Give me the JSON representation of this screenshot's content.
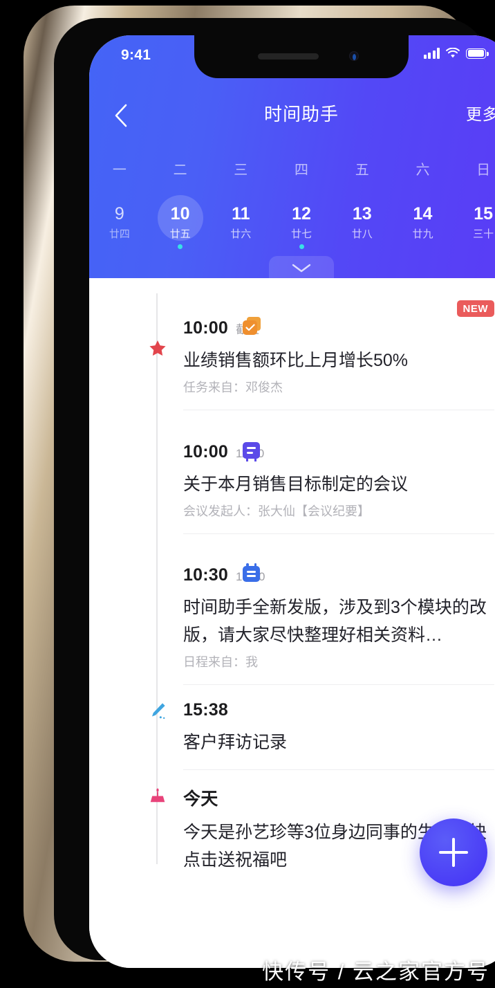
{
  "status_bar": {
    "time": "9:41",
    "signal_icon": "signal-bars-icon",
    "wifi_icon": "wifi-icon",
    "battery_icon": "battery-icon"
  },
  "header": {
    "back_icon": "chevron-left-icon",
    "title": "时间助手",
    "more_label": "更多",
    "expand_icon": "chevron-down-icon",
    "gradient_from": "#4464f6",
    "gradient_to": "#5a3cf6"
  },
  "calendar": {
    "weekdays": [
      "一",
      "二",
      "三",
      "四",
      "五",
      "六",
      "日"
    ],
    "days": [
      {
        "num": "9",
        "lunar": "廿四",
        "selected": false,
        "dot": false,
        "dim": true
      },
      {
        "num": "10",
        "lunar": "廿五",
        "selected": true,
        "dot": true,
        "dim": false
      },
      {
        "num": "11",
        "lunar": "廿六",
        "selected": false,
        "dot": false,
        "dim": false
      },
      {
        "num": "12",
        "lunar": "廿七",
        "selected": false,
        "dot": true,
        "dim": false
      },
      {
        "num": "13",
        "lunar": "廿八",
        "selected": false,
        "dot": false,
        "dim": false
      },
      {
        "num": "14",
        "lunar": "廿九",
        "selected": false,
        "dot": false,
        "dim": false
      },
      {
        "num": "15",
        "lunar": "三十",
        "selected": false,
        "dot": false,
        "dim": false
      }
    ],
    "dot_color": "#38e0e6"
  },
  "timeline": {
    "items": [
      {
        "icon": "task-checkbox-icon",
        "icon_color": "#ef8f2e",
        "secondary_icon": "star-icon",
        "secondary_icon_color": "#e2454c",
        "time": "10:00",
        "sub": "截止",
        "title": "业绩销售额环比上月增长50%",
        "meta": "任务来自：邓俊杰",
        "badge": "NEW",
        "badge_color": "#ea5b5b"
      },
      {
        "icon": "meeting-bubble-icon",
        "icon_color": "#5b4ae8",
        "time": "10:00",
        "sub": "11:00",
        "title": "关于本月销售目标制定的会议",
        "meta": "会议发起人：张大仙【会议纪要】",
        "badge": ""
      },
      {
        "icon": "schedule-calendar-icon",
        "icon_color": "#3a6ee8",
        "time": "10:30",
        "sub": "16:00",
        "title": "时间助手全新发版，涉及到3个模块的改版，请大家尽快整理好相关资料…",
        "meta": "日程来自：我",
        "badge": ""
      },
      {
        "icon": "pencil-edit-icon",
        "icon_color": "#3fa5e0",
        "time": "15:38",
        "sub": "",
        "title": "客户拜访记录",
        "meta": "",
        "badge": ""
      },
      {
        "icon": "birthday-cake-icon",
        "icon_color": "#e8437a",
        "time": "今天",
        "sub": "",
        "title": "今天是孙艺珍等3位身边同事的生日，快点击送祝福吧",
        "meta": "",
        "badge": ""
      }
    ]
  },
  "fab": {
    "icon": "plus-icon",
    "color": "#4a3df6"
  },
  "watermark": {
    "text": "快传号 / 云之家官方号"
  }
}
